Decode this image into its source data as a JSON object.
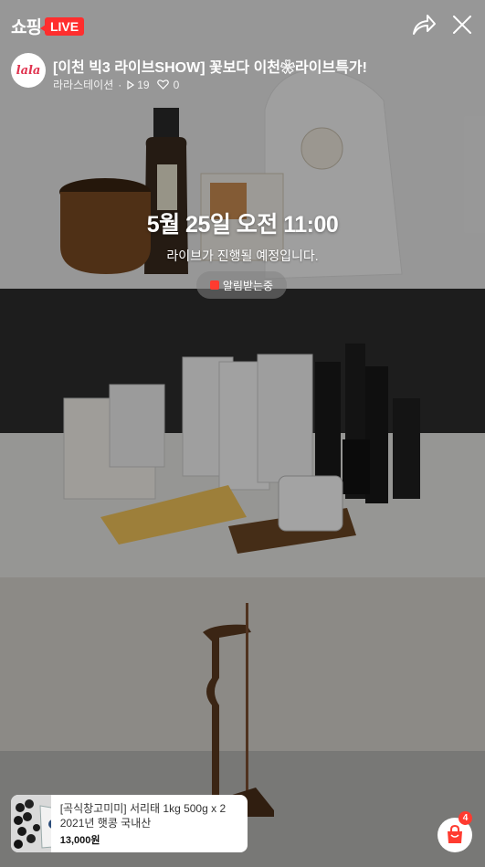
{
  "header": {
    "brand": "쇼핑",
    "live_badge": "LIVE",
    "share_icon": "share-icon",
    "close_icon": "close-icon"
  },
  "channel": {
    "avatar_text": "lala",
    "title": "[이천 빅3 라이브SHOW] 꽃보다 이천❀라이브특가!",
    "name": "라라스테이션",
    "separator": "·",
    "views": "19",
    "likes": "0"
  },
  "schedule": {
    "date_time": "5월 25일 오전 11:00",
    "notice": "라이브가 진행될 예정입니다.",
    "alarm_label": "알림받는중"
  },
  "product": {
    "name": "[곡식창고미미] 서리태 1kg 500g x 2 2021년 햇콩 국내산",
    "price": "13,000원"
  },
  "cart": {
    "count": "4"
  },
  "colors": {
    "live_red": "#ff2e2e",
    "cart_red": "#ff3b30",
    "avatar_pink": "#e0334f"
  }
}
